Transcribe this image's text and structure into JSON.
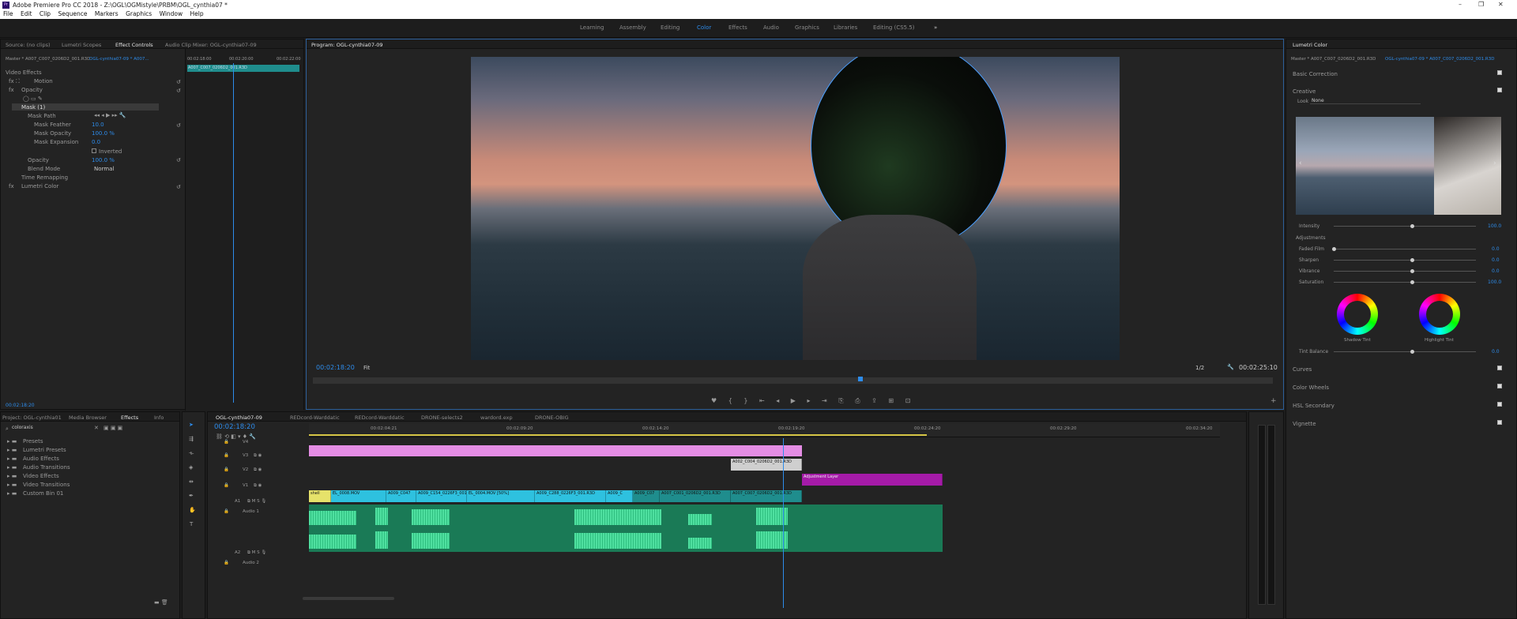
{
  "app": {
    "title": "Adobe Premiere Pro CC 2018 - Z:\\OGL\\OGMistyle\\PRBM\\OGL_cynthia07 *",
    "logo": "Pr"
  },
  "window_controls": {
    "minimize": "–",
    "maximize": "❐",
    "close": "✕"
  },
  "menu": [
    "File",
    "Edit",
    "Clip",
    "Sequence",
    "Markers",
    "Graphics",
    "Window",
    "Help"
  ],
  "workspaces": [
    {
      "label": "Learning"
    },
    {
      "label": "Assembly"
    },
    {
      "label": "Editing"
    },
    {
      "label": "Color",
      "active": true
    },
    {
      "label": "Effects"
    },
    {
      "label": "Audio"
    },
    {
      "label": "Graphics"
    },
    {
      "label": "Libraries"
    },
    {
      "label": "Editing (CS5.5)"
    }
  ],
  "workspace_more": "»",
  "source_panel": {
    "tabs": [
      "Source: (no clips)",
      "Lumetri Scopes",
      "Effect Controls",
      "Audio Clip Mixer: OGL-cynthia07-09"
    ],
    "master": "Master * A007_C007_0206D2_001.R3D",
    "master_seq": "OGL-cynthia07-09 * A007...",
    "ruler": [
      "00:02:18:00",
      "00:02:20:00",
      "00:02:22:00"
    ],
    "clip_label": "A007_C007_0206D2_001.R3D",
    "video_effects": "Video Effects",
    "motion": "Motion",
    "opacity": "Opacity",
    "mask": "Mask (1)",
    "mask_path": "Mask Path",
    "mask_feather": "Mask Feather",
    "mask_feather_val": "10.0",
    "mask_opacity": "Mask Opacity",
    "mask_opacity_val": "100.0 %",
    "mask_expansion": "Mask Expansion",
    "mask_expansion_val": "0.0",
    "inverted": "Inverted",
    "opacity2": "Opacity",
    "opacity2_val": "100.0 %",
    "blend_mode": "Blend Mode",
    "blend_mode_val": "Normal",
    "time_remap": "Time Remapping",
    "lumetri": "Lumetri Color",
    "timecode": "00:02:18:20"
  },
  "program": {
    "tab": "Program: OGL-cynthia07-09",
    "timecode": "00:02:18:20",
    "fit": "Fit",
    "quality": "1/2",
    "duration": "00:02:25:10"
  },
  "project": {
    "tabs": [
      "Project: OGL-cynthia01",
      "Media Browser",
      "Effects",
      "Info"
    ],
    "search": "coloraxis",
    "items": [
      "Presets",
      "Lumetri Presets",
      "Audio Effects",
      "Audio Transitions",
      "Video Effects",
      "Video Transitions",
      "Custom Bin 01"
    ]
  },
  "timeline": {
    "tabs": [
      "OGL-cynthia07-09",
      "REDcord-Warddatic",
      "REDcord-Warddatic",
      "DRONE-selects2",
      "wardord.exp",
      "DRONE-OBIG"
    ],
    "timecode": "00:02:18:20",
    "ruler": [
      "00:02:04:21",
      "00:02:09:20",
      "00:02:14:20",
      "00:02:19:20",
      "00:02:24:20",
      "00:02:29:20",
      "00:02:34:20"
    ],
    "tracks_v": [
      "V4",
      "V3",
      "V2",
      "V1"
    ],
    "tracks_a": [
      "A1",
      "A2"
    ],
    "audio1": "Audio 1",
    "audio2": "Audio 2",
    "clips": {
      "v3": "A002_C004_0206D2_001.R3D",
      "v2": "Adjustment Layer",
      "v1": [
        "shell",
        "EL_0008.MOV",
        "A009_C047",
        "A009_C154_0226F3_001.R3D",
        "EL_0004.MOV [50%]",
        "A009_C288_0226F3_001.R3D",
        "A009_C",
        "A009_C07",
        "A007_C001_0206D2_001.R3D",
        "A007_C007_0206D2_001.R3D"
      ]
    }
  },
  "lumetri": {
    "tab": "Lumetri Color",
    "master": "Master * A007_C007_0206D2_001.R3D",
    "seq": "OGL-cynthia07-09 * A007_C007_0206D2_001.R3D",
    "basic": "Basic Correction",
    "creative": "Creative",
    "look": "Look",
    "look_val": "None",
    "intensity": "Intensity",
    "intensity_val": "100.0",
    "adjustments": "Adjustments",
    "faded": "Faded Film",
    "faded_val": "0.0",
    "sharpen": "Sharpen",
    "sharpen_val": "0.0",
    "vibrance": "Vibrance",
    "vibrance_val": "0.0",
    "saturation": "Saturation",
    "saturation_val": "100.0",
    "shadow_tint": "Shadow Tint",
    "highlight_tint": "Highlight Tint",
    "tint_balance": "Tint Balance",
    "tint_balance_val": "0.0",
    "curves": "Curves",
    "wheels": "Color Wheels",
    "hsl": "HSL Secondary",
    "vignette": "Vignette"
  },
  "colors": {
    "accent": "#2d8ceb",
    "pink": "#e48de4",
    "cyan": "#2ec1df",
    "purple": "#a51ba8",
    "audio": "#1a7a56",
    "wave": "#4fe0a0",
    "yellow": "#e6e26a"
  }
}
